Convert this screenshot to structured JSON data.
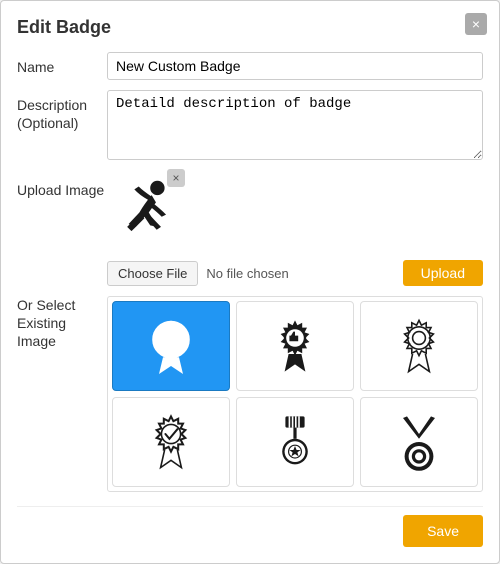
{
  "dialog": {
    "title": "Edit Badge",
    "close_label": "×"
  },
  "form": {
    "name_label": "Name",
    "name_value": "New Custom Badge",
    "name_placeholder": "New Custom Badge",
    "description_label": "Description (Optional)",
    "description_value": "Detaild description of badge",
    "description_placeholder": "Detaild description of badge",
    "upload_label": "Upload Image",
    "choose_file_label": "Choose File",
    "no_file_text": "No file chosen",
    "upload_btn_label": "Upload",
    "select_existing_label": "Or Select Existing Image"
  },
  "footer": {
    "save_label": "Save"
  },
  "badges": [
    {
      "id": "badge-1",
      "selected": true
    },
    {
      "id": "badge-2",
      "selected": false
    },
    {
      "id": "badge-3",
      "selected": false
    },
    {
      "id": "badge-4",
      "selected": false
    },
    {
      "id": "badge-5",
      "selected": false
    },
    {
      "id": "badge-6",
      "selected": false
    }
  ]
}
